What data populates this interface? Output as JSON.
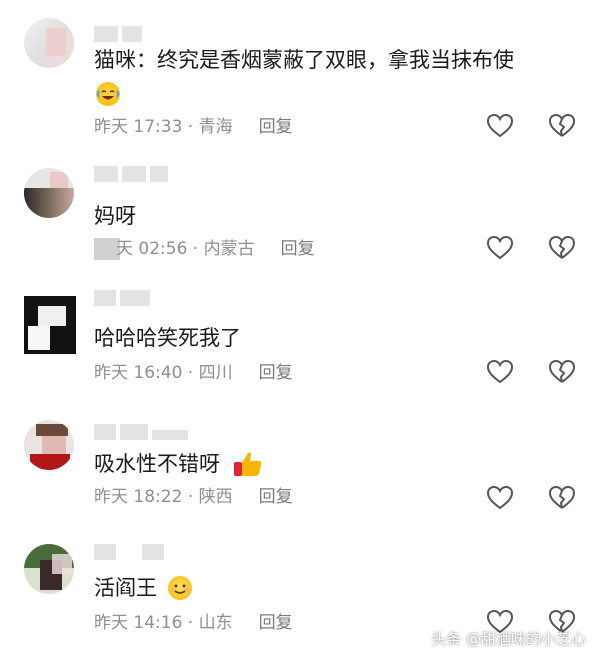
{
  "comments": [
    {
      "text": "猫咪：终究是香烟蒙蔽了双眼，拿我当抹布使",
      "emoji": "laughing-crying-emoji",
      "time": "昨天 17:33",
      "location": "青海",
      "reply_label": "回复"
    },
    {
      "text": "妈呀",
      "time": "天 02:56",
      "location": "内蒙古",
      "reply_label": "回复"
    },
    {
      "text": "哈哈哈笑死我了",
      "time": "昨天 16:40",
      "location": "四川",
      "reply_label": "回复"
    },
    {
      "text": "吸水性不错呀",
      "emoji": "thumbs-up-emoji",
      "time": "昨天 18:22",
      "location": "陕西",
      "reply_label": "回复"
    },
    {
      "text": "活阎王",
      "emoji": "smiling-face-emoji",
      "time": "昨天 14:16",
      "location": "山东",
      "reply_label": "回复"
    }
  ],
  "meta_separator": " · ",
  "watermark": "头条 @甜酒味的小芝心",
  "icons": {
    "like": "heart-outline-icon",
    "dislike": "broken-heart-outline-icon"
  },
  "colors": {
    "text": "#1a1a1a",
    "meta": "#8f8f8f",
    "icon": "#555555"
  }
}
